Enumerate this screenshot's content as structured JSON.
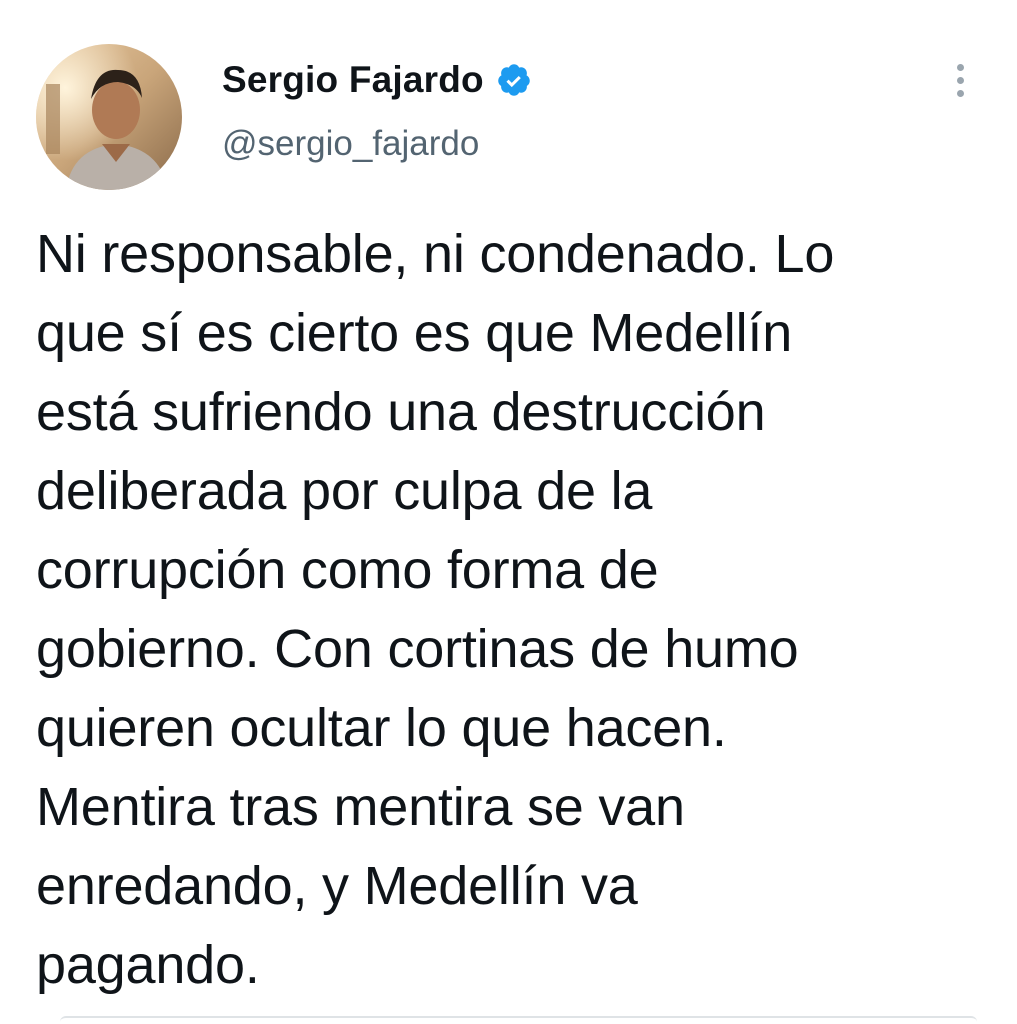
{
  "author": {
    "display_name": "Sergio Fajardo",
    "handle": "@sergio_fajardo",
    "verified": true,
    "verified_icon": "verified-badge-icon",
    "avatar_icon": "profile-photo"
  },
  "menu": {
    "icon": "more-options-vertical-icon"
  },
  "tweet": {
    "text": "Ni responsable, ni condenado. Lo\nque sí es cierto es que Medellín\nestá sufriendo una destrucción\ndeliberada por culpa de la\ncorrupción como forma de\ngobierno. Con cortinas de humo\nquieren ocultar lo que hacen.\nMentira tras mentira se van\nenredando, y Medellín va\npagando."
  },
  "colors": {
    "verified": "#1d9bf0",
    "text": "#0f1419",
    "secondary": "#536471"
  }
}
